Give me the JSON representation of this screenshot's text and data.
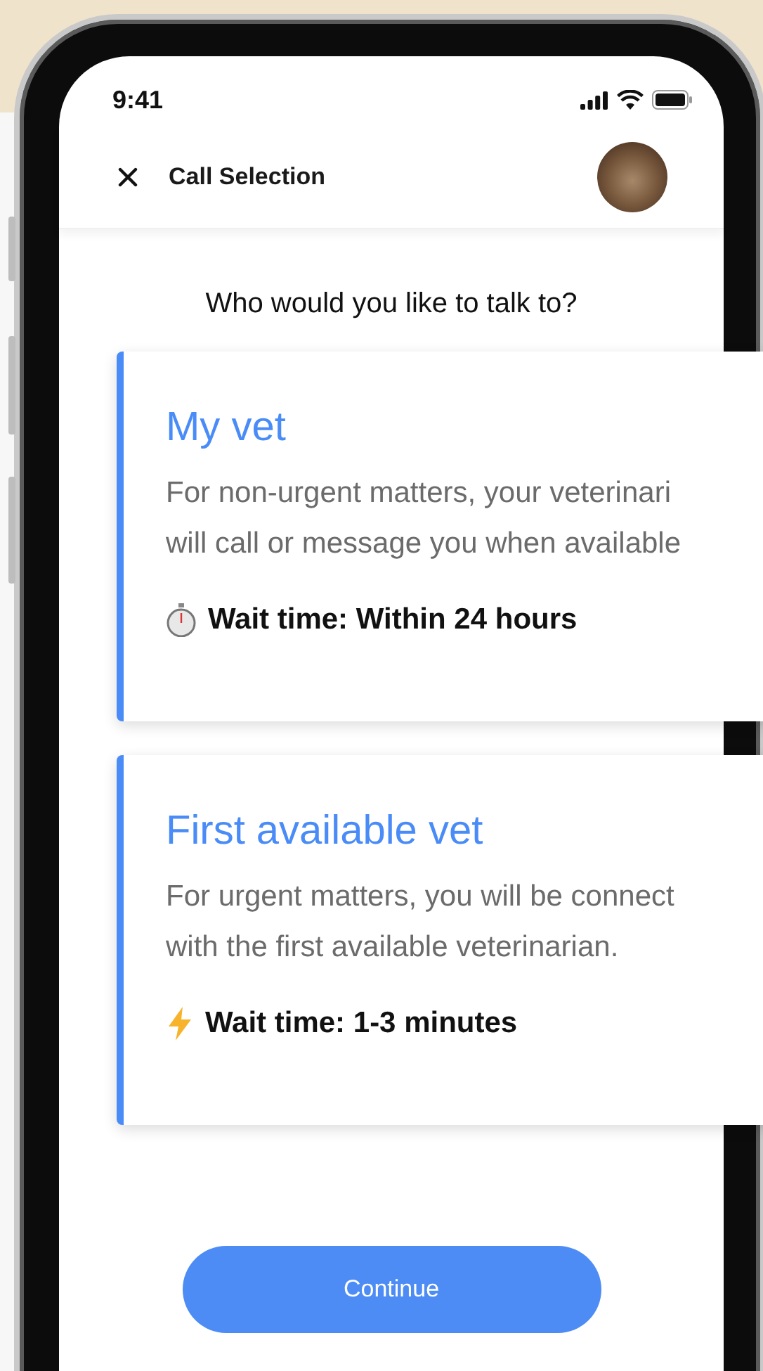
{
  "status_bar": {
    "time": "9:41"
  },
  "header": {
    "title": "Call Selection"
  },
  "prompt": "Who would you like to talk to?",
  "options": [
    {
      "kind": "timer",
      "title": "My vet",
      "description": [
        "For non-urgent matters, your veterinari",
        "will call or message you when available"
      ],
      "wait_time": "Wait time: Within 24 hours"
    },
    {
      "kind": "lightning",
      "title": "First available vet",
      "description": [
        "For urgent matters, you will be connect",
        "with the first available veterinarian."
      ],
      "wait_time": "Wait time: 1-3 minutes"
    }
  ],
  "continue_button": {
    "label": "Continue"
  }
}
